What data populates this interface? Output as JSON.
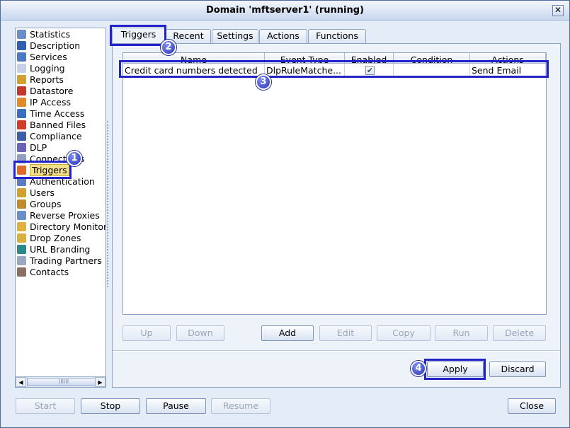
{
  "window": {
    "title": "Domain 'mftserver1' (running)",
    "close_glyph": "✕"
  },
  "sidebar": {
    "items": [
      {
        "label": "Statistics",
        "icon": "statistics-icon",
        "color": "#6a8fc8"
      },
      {
        "label": "Description",
        "icon": "person-icon",
        "color": "#2f5fb3"
      },
      {
        "label": "Services",
        "icon": "services-icon",
        "color": "#4a79c2"
      },
      {
        "label": "Logging",
        "icon": "logging-icon",
        "color": "#c8d0e8"
      },
      {
        "label": "Reports",
        "icon": "reports-icon",
        "color": "#d0a030"
      },
      {
        "label": "Datastore",
        "icon": "datastore-icon",
        "color": "#c0392b"
      },
      {
        "label": "IP Access",
        "icon": "ip-access-icon",
        "color": "#e08a2b"
      },
      {
        "label": "Time Access",
        "icon": "clock-icon",
        "color": "#3a6fc0"
      },
      {
        "label": "Banned Files",
        "icon": "banned-icon",
        "color": "#d23a2a"
      },
      {
        "label": "Compliance",
        "icon": "compliance-icon",
        "color": "#3c5fa8"
      },
      {
        "label": "DLP",
        "icon": "shield-icon",
        "color": "#6b63b5"
      },
      {
        "label": "Connections",
        "icon": "connections-icon",
        "color": "#8fa0c0"
      },
      {
        "label": "Triggers",
        "icon": "triggers-icon",
        "color": "#e06a2a"
      },
      {
        "label": "Authentication",
        "icon": "authentication-icon",
        "color": "#5a7cc0"
      },
      {
        "label": "Users",
        "icon": "user-icon",
        "color": "#d0a030"
      },
      {
        "label": "Groups",
        "icon": "groups-icon",
        "color": "#c08a30"
      },
      {
        "label": "Reverse Proxies",
        "icon": "proxy-icon",
        "color": "#6a8fc8"
      },
      {
        "label": "Directory Monitor",
        "icon": "directory-icon",
        "color": "#e0b040"
      },
      {
        "label": "Drop Zones",
        "icon": "dropzone-icon",
        "color": "#d8b040"
      },
      {
        "label": "URL Branding",
        "icon": "globe-icon",
        "color": "#2a8a8a"
      },
      {
        "label": "Trading Partners",
        "icon": "partners-icon",
        "color": "#9aa8c0"
      },
      {
        "label": "Contacts",
        "icon": "contacts-icon",
        "color": "#8a7060"
      }
    ],
    "selected_index": 12,
    "scroll_thumb_glyph": "IIIIII",
    "scroll_left_glyph": "◀",
    "scroll_right_glyph": "▶"
  },
  "tabs": [
    "Triggers",
    "Recent",
    "Settings",
    "Actions",
    "Functions"
  ],
  "active_tab": "Triggers",
  "table": {
    "columns": [
      "Name",
      "Event Type",
      "Enabled",
      "Condition",
      "Actions"
    ],
    "rows": [
      {
        "name": "Credit card numbers detected",
        "event_type": "DlpRuleMatche...",
        "enabled": true,
        "condition": "",
        "actions": "Send Email"
      }
    ],
    "check_glyph": "✔"
  },
  "table_buttons": [
    "Up",
    "Down",
    "Add",
    "Edit",
    "Copy",
    "Run",
    "Delete"
  ],
  "panel_buttons": {
    "apply": "Apply",
    "discard": "Discard"
  },
  "footer_buttons": [
    "Start",
    "Stop",
    "Pause",
    "Resume",
    "Close"
  ],
  "annotations": [
    "1",
    "2",
    "3",
    "4"
  ],
  "colors": {
    "highlight": "#2323c7",
    "selected_bg": "#f4df8a",
    "window_bg": "#e4ecf7"
  }
}
